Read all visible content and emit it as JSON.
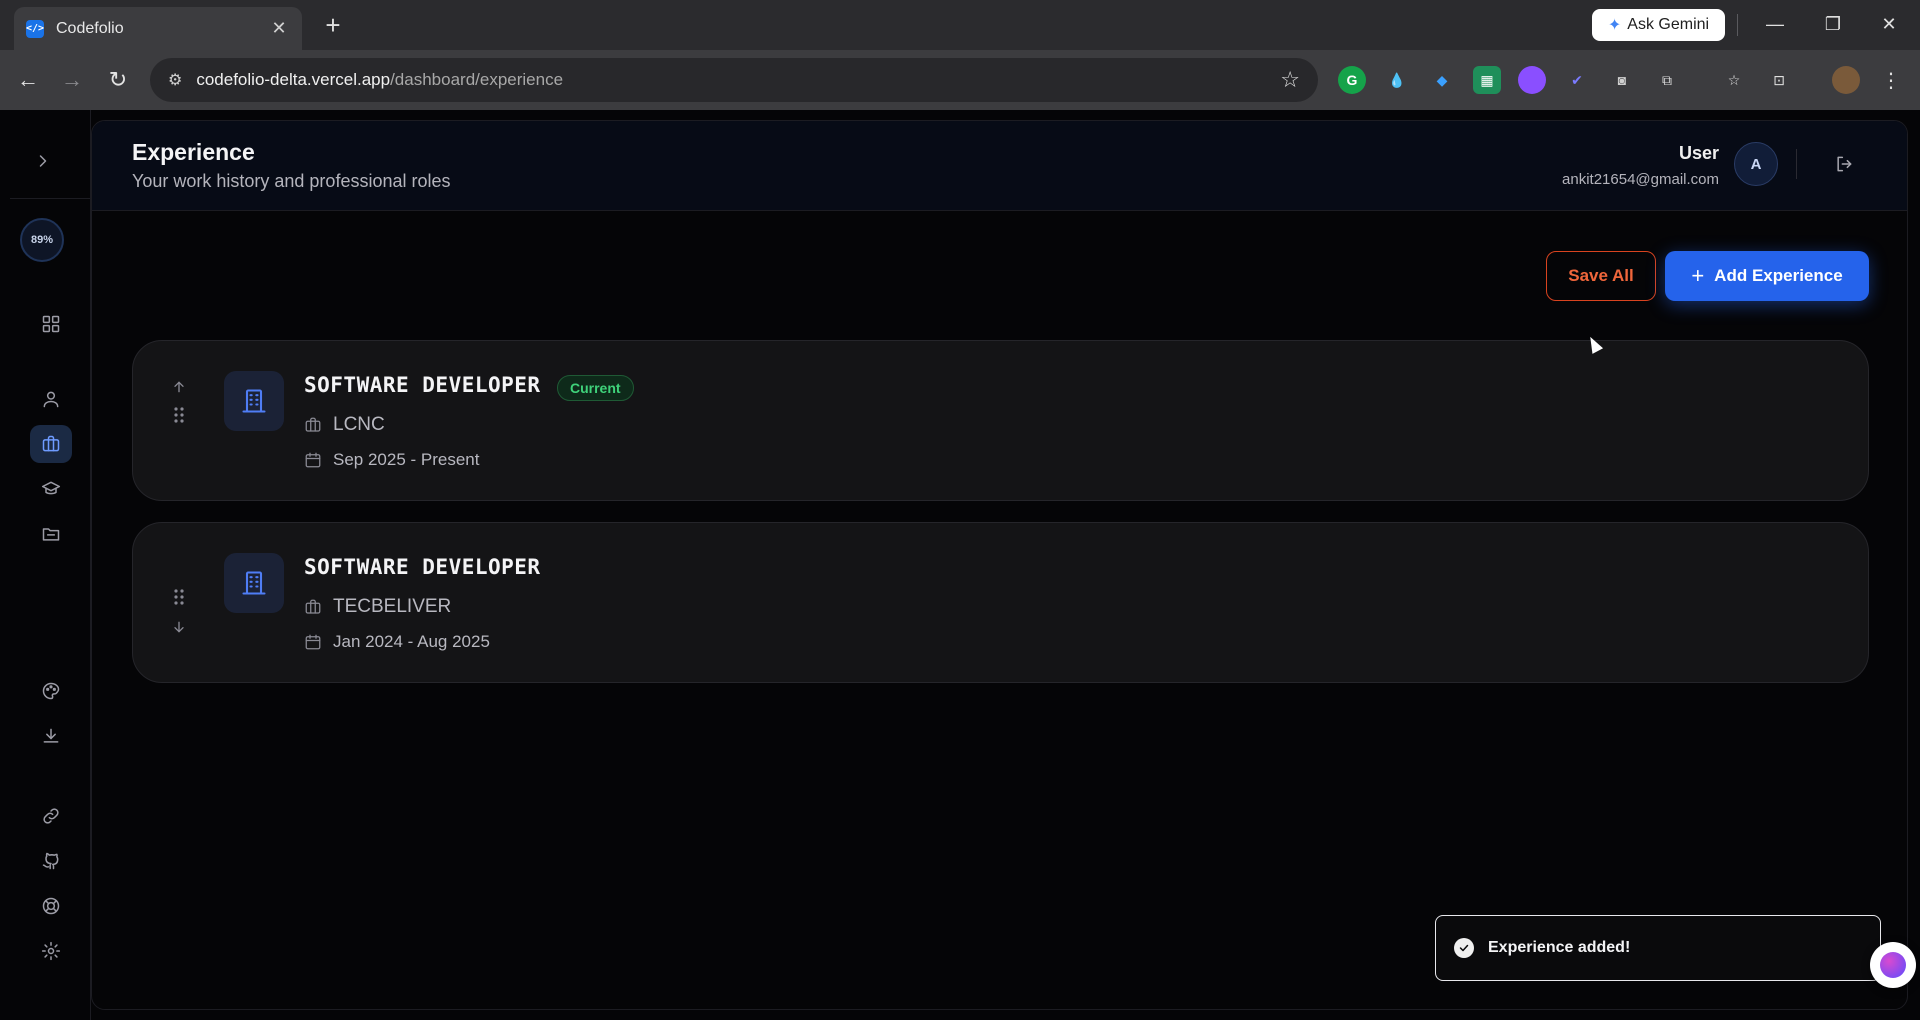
{
  "browser": {
    "tab_title": "Codefolio",
    "tab_close": "✕",
    "new_tab": "+",
    "gemini_label": "Ask Gemini",
    "url_host": "codefolio-delta.vercel.app",
    "url_path": "/dashboard/experience",
    "window_controls": {
      "minimize": "—",
      "restore": "❐",
      "close": "✕"
    }
  },
  "sidebar": {
    "toggle": "›",
    "progress": "89%",
    "items": [
      {
        "icon": "dashboard-icon"
      },
      {
        "icon": "profile-icon"
      },
      {
        "icon": "briefcase-icon",
        "active": true
      },
      {
        "icon": "graduation-cap-icon"
      },
      {
        "icon": "projects-folder-icon"
      },
      {
        "icon": "palette-icon"
      },
      {
        "icon": "download-icon"
      },
      {
        "icon": "link-icon"
      },
      {
        "icon": "github-icon"
      },
      {
        "icon": "help-icon"
      },
      {
        "icon": "settings-icon"
      }
    ]
  },
  "header": {
    "title": "Experience",
    "subtitle": "Your work history and professional roles",
    "user_name": "User",
    "user_email": "ankit21654@gmail.com",
    "avatar_initial": "A"
  },
  "actions": {
    "save_all": "Save All",
    "add_plus": "+",
    "add_experience": "Add Experience"
  },
  "experiences": [
    {
      "role": "SOFTWARE DEVELOPER",
      "badge": "Current",
      "company": "LCNC",
      "dates": "Sep 2025 - Present"
    },
    {
      "role": "SOFTWARE DEVELOPER",
      "badge": "",
      "company": "TECBELIVER",
      "dates": "Jan 2024 - Aug 2025"
    }
  ],
  "toast": {
    "message": "Experience added!"
  },
  "colors": {
    "accent": "#2563eb",
    "save_border": "#d9431f",
    "current_badge": "#3fd27a",
    "background": "#050507",
    "card": "#141416"
  }
}
